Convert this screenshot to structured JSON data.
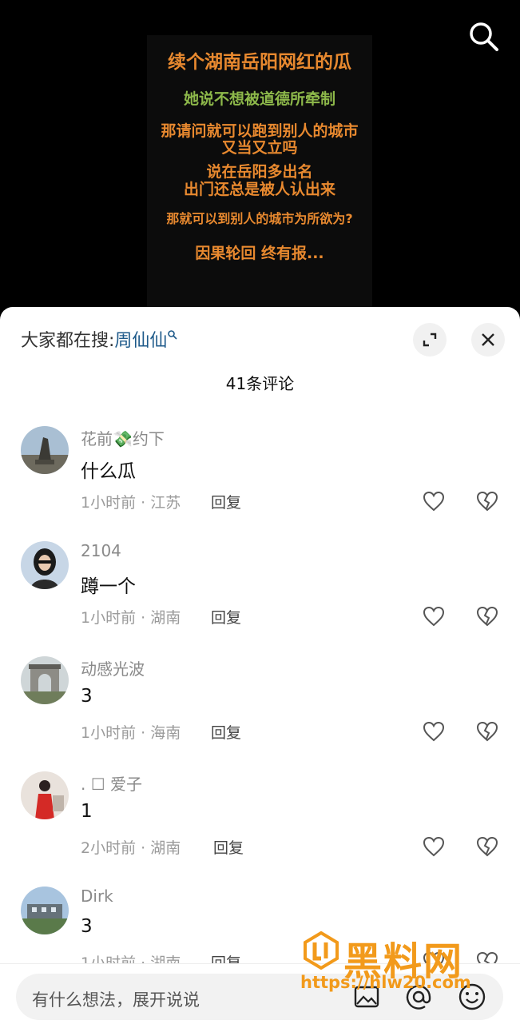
{
  "video": {
    "lines": [
      "续个湖南岳阳网红的瓜",
      "她说不想被道德所牵制",
      "那请问就可以跑到别人的城市",
      "又当又立吗",
      "说在岳阳多出名",
      "出门还总是被人认出来",
      "那就可以到别人的城市为所欲为?",
      "因果轮回 终有报..."
    ]
  },
  "trending": {
    "label": "大家都在搜:",
    "term": "周仙仙"
  },
  "comments_count": "41条评论",
  "comments": [
    {
      "user": "花前💸约下",
      "text": "什么瓜",
      "time": "1小时前 · 江苏",
      "reply": "回复"
    },
    {
      "user": "2104",
      "text": "蹲一个",
      "time": "1小时前 · 湖南",
      "reply": "回复"
    },
    {
      "user": "动感光波",
      "text": "3",
      "time": "1小时前 · 海南",
      "reply": "回复"
    },
    {
      "user": ". ☐   爱子",
      "text": "1",
      "time": "2小时前 · 湖南",
      "reply": "回复"
    },
    {
      "user": "Dirk",
      "text": "3",
      "time": "1小时前 · 湖南",
      "reply": "回复"
    }
  ],
  "input": {
    "placeholder": "有什么想法，展开说说"
  },
  "watermark": {
    "title": "黑料网",
    "url": "https://hlw20.com"
  },
  "colors": {
    "video_text": "#e8892f",
    "video_green": "#8db84a",
    "link": "#1e5a8a",
    "watermark": "#f29a1b"
  }
}
